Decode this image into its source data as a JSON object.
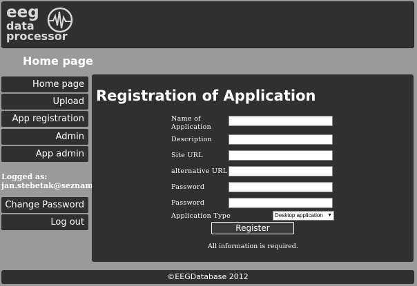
{
  "logo": {
    "line1": "eeg",
    "line2": "data",
    "line3": "processor",
    "icon": "brain-wave-icon"
  },
  "page_title": "Home page",
  "nav": [
    {
      "label": "Home page"
    },
    {
      "label": "Upload"
    },
    {
      "label": "App registration"
    },
    {
      "label": "Admin"
    },
    {
      "label": "App admin"
    }
  ],
  "user": {
    "logged_label": "Logged as:",
    "email": "jan.stebetak@seznam.cz"
  },
  "account": [
    {
      "label": "Change Password"
    },
    {
      "label": "Log out"
    }
  ],
  "form": {
    "title": "Registration of Application",
    "fields": {
      "name_line1": "Name of",
      "name_line2": "Application",
      "description": "Description",
      "site_url": "Site URL",
      "alternative_url": "alternative URL",
      "password": "Password",
      "password_confirm": "Password",
      "application_type": "Application Type"
    },
    "values": {
      "name": "",
      "description": "",
      "site_url": "",
      "alternative_url": "",
      "password": "",
      "password_confirm": ""
    },
    "app_type_selected": "Desktop application",
    "register_label": "Register",
    "note": "All information is required."
  },
  "footer": "©EEGDatabase 2012"
}
